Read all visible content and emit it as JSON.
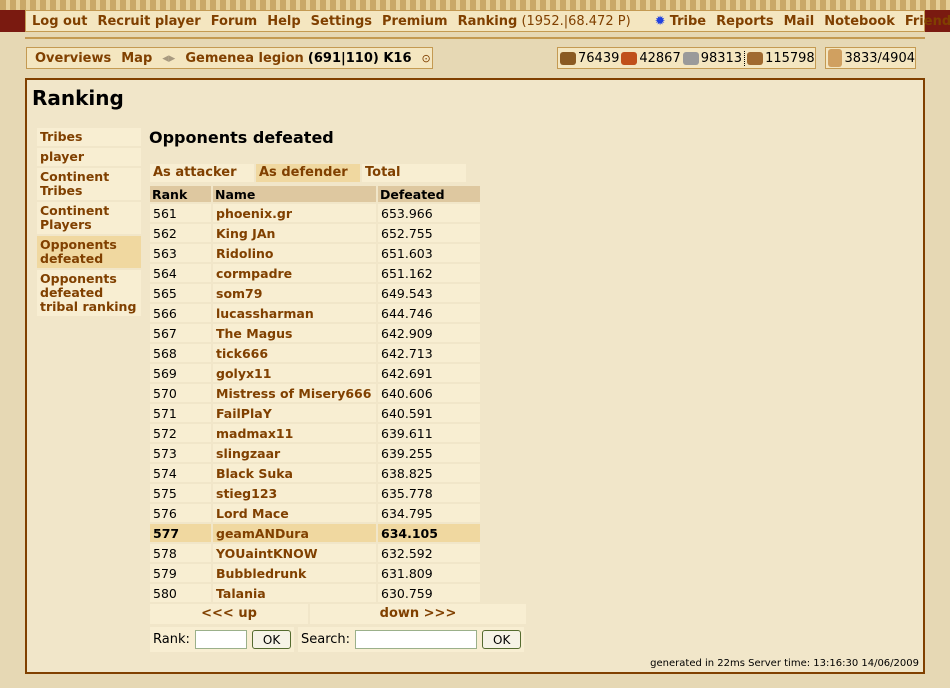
{
  "menu": {
    "items": [
      "Log out",
      "Recruit player",
      "Forum",
      "Help",
      "Settings",
      "Premium"
    ],
    "ranking": "Ranking",
    "ranking_detail": "(1952.|68.472 P)",
    "right": [
      "Tribe",
      "Reports",
      "Mail",
      "Notebook",
      "Friends"
    ]
  },
  "village": {
    "overviews": "Overviews",
    "map": "Map",
    "name": "Gemenea legion",
    "coords": "(691|110) K16"
  },
  "resources": {
    "wood": "76439",
    "clay": "42867",
    "iron": "98313",
    "storage": "115798",
    "population": "3833/4904",
    "colors": {
      "wood": "#8a5a22",
      "clay": "#c0501a",
      "iron": "#9a9a9a",
      "storage": "#a06a30"
    }
  },
  "page": {
    "title": "Ranking",
    "heading": "Opponents defeated"
  },
  "sidebar": [
    {
      "label": "Tribes"
    },
    {
      "label": "player"
    },
    {
      "label": "Continent Tribes"
    },
    {
      "label": "Continent Players"
    },
    {
      "label": "Opponents defeated",
      "active": true
    },
    {
      "label": "Opponents defeated tribal ranking"
    }
  ],
  "tabs": [
    {
      "label": "As attacker"
    },
    {
      "label": "As defender",
      "active": true
    },
    {
      "label": "Total"
    }
  ],
  "table": {
    "headers": [
      "Rank",
      "Name",
      "Defeated"
    ],
    "rows": [
      [
        "561",
        "phoenix.gr",
        "653.966"
      ],
      [
        "562",
        "King JAn",
        "652.755"
      ],
      [
        "563",
        "Ridolino",
        "651.603"
      ],
      [
        "564",
        "cormpadre",
        "651.162"
      ],
      [
        "565",
        "som79",
        "649.543"
      ],
      [
        "566",
        "lucassharman",
        "644.746"
      ],
      [
        "567",
        "The Magus",
        "642.909"
      ],
      [
        "568",
        "tick666",
        "642.713"
      ],
      [
        "569",
        "golyx11",
        "642.691"
      ],
      [
        "570",
        "Mistress of Misery666",
        "640.606"
      ],
      [
        "571",
        "FailPlaY",
        "640.591"
      ],
      [
        "572",
        "madmax11",
        "639.611"
      ],
      [
        "573",
        "slingzaar",
        "639.255"
      ],
      [
        "574",
        "Black Suka",
        "638.825"
      ],
      [
        "575",
        "stieg123",
        "635.778"
      ],
      [
        "576",
        "Lord Mace",
        "634.795"
      ],
      [
        "577",
        "geamANDura",
        "634.105"
      ],
      [
        "578",
        "YOUaintKNOW",
        "632.592"
      ],
      [
        "579",
        "Bubbledrunk",
        "631.809"
      ],
      [
        "580",
        "Talania",
        "630.759"
      ]
    ],
    "highlight_rank": "577"
  },
  "nav": {
    "up": "<<< up",
    "down": "down >>>"
  },
  "forms": {
    "rank_label": "Rank:",
    "rank_value": "",
    "ok": "OK",
    "search_label": "Search:",
    "search_value": ""
  },
  "footer": "generated in 22ms Server time: 13:16:30 14/06/2009"
}
